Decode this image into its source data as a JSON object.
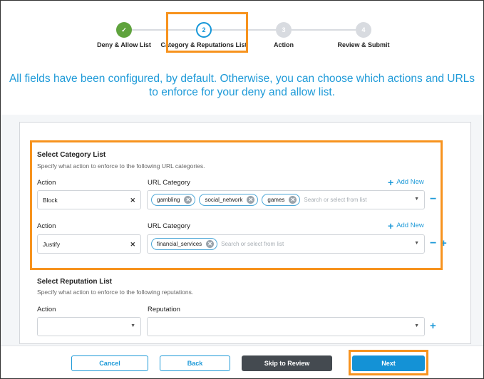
{
  "stepper": {
    "steps": [
      {
        "label": "Deny & Allow List",
        "number": "✓",
        "state": "done"
      },
      {
        "label": "Category & Reputations List",
        "number": "2",
        "state": "active"
      },
      {
        "label": "Action",
        "number": "3",
        "state": "todo"
      },
      {
        "label": "Review & Submit",
        "number": "4",
        "state": "todo"
      }
    ]
  },
  "headline": "All fields have been configured, by default. Otherwise, you can choose which actions and URLs to enforce for your deny and allow list.",
  "category_section": {
    "title": "Select Category List",
    "description": "Specify what action to enforce to the following URL categories.",
    "action_label": "Action",
    "url_label": "URL Category",
    "add_new": "Add New",
    "rows": [
      {
        "action": "Block",
        "tags": [
          "gambling",
          "social_network",
          "games"
        ],
        "placeholder": "Search or select from list"
      },
      {
        "action": "Justify",
        "tags": [
          "financial_services"
        ],
        "placeholder": "Search or select from list"
      }
    ]
  },
  "reputation_section": {
    "title": "Select Reputation List",
    "description": "Specify what action to enforce to the following reputations.",
    "action_label": "Action",
    "reputation_label": "Reputation"
  },
  "footer": {
    "cancel": "Cancel",
    "back": "Back",
    "skip": "Skip to Review",
    "next": "Next"
  },
  "colors": {
    "accent": "#1e9ad8",
    "highlight": "#f7931e",
    "done": "#5fa33d"
  }
}
